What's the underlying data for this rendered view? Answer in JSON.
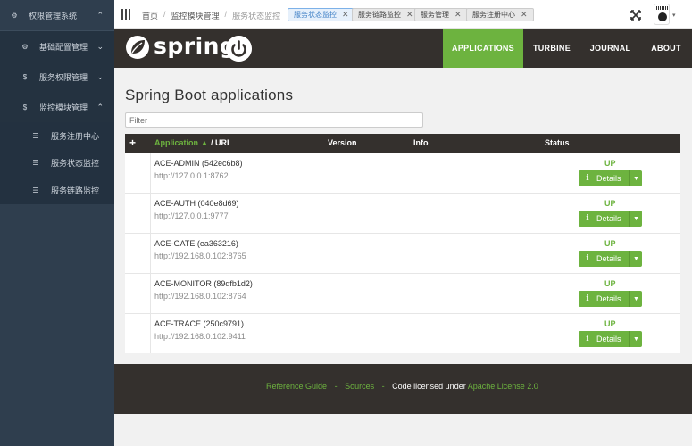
{
  "sidebar": {
    "items": [
      {
        "label": "权限管理系统",
        "icon": "gear-icon",
        "chevron": "up"
      },
      {
        "label": "基础配置管理",
        "icon": "gear-icon",
        "chevron": "down"
      },
      {
        "label": "服务权限管理",
        "icon": "s-icon",
        "chevron": "down"
      },
      {
        "label": "监控模块管理",
        "icon": "s-icon",
        "chevron": "up"
      },
      {
        "label": "服务注册中心",
        "icon": "list-icon"
      },
      {
        "label": "服务状态监控",
        "icon": "list-icon"
      },
      {
        "label": "服务链路监控",
        "icon": "list-icon"
      }
    ]
  },
  "topbar": {
    "breadcrumb": [
      "首页",
      "监控模块管理",
      "服务状态监控"
    ],
    "tabs": [
      {
        "label": "服务状态监控",
        "active": true
      },
      {
        "label": "服务链路监控",
        "active": false
      },
      {
        "label": "服务管理",
        "active": false
      },
      {
        "label": "服务注册中心",
        "active": false
      }
    ],
    "close_glyph": "✕"
  },
  "spring": {
    "logo_text": "spring",
    "nav": [
      "APPLICATIONS",
      "TURBINE",
      "JOURNAL",
      "ABOUT"
    ],
    "active_nav": "APPLICATIONS",
    "brand_color": "#6db33f",
    "header_color": "#34302d"
  },
  "main": {
    "title": "Spring Boot applications",
    "filter_placeholder": "Filter",
    "columns": {
      "plus": "+",
      "application": "Application",
      "sort_arrow": "▲",
      "url": "/ URL",
      "version": "Version",
      "info": "Info",
      "status": "Status"
    },
    "details_label": "Details",
    "apps": [
      {
        "name": "ACE-ADMIN (542ec6b8)",
        "url": "http://127.0.0.1:8762",
        "status": "UP"
      },
      {
        "name": "ACE-AUTH (040e8d69)",
        "url": "http://127.0.0.1:9777",
        "status": "UP"
      },
      {
        "name": "ACE-GATE (ea363216)",
        "url": "http://192.168.0.102:8765",
        "status": "UP"
      },
      {
        "name": "ACE-MONITOR (89dfb1d2)",
        "url": "http://192.168.0.102:8764",
        "status": "UP"
      },
      {
        "name": "ACE-TRACE (250c9791)",
        "url": "http://192.168.0.102:9411",
        "status": "UP"
      }
    ]
  },
  "footer": {
    "reference_guide": "Reference Guide",
    "dash": "-",
    "sources": "Sources",
    "licensed": "Code licensed under",
    "license": "Apache License 2.0"
  }
}
